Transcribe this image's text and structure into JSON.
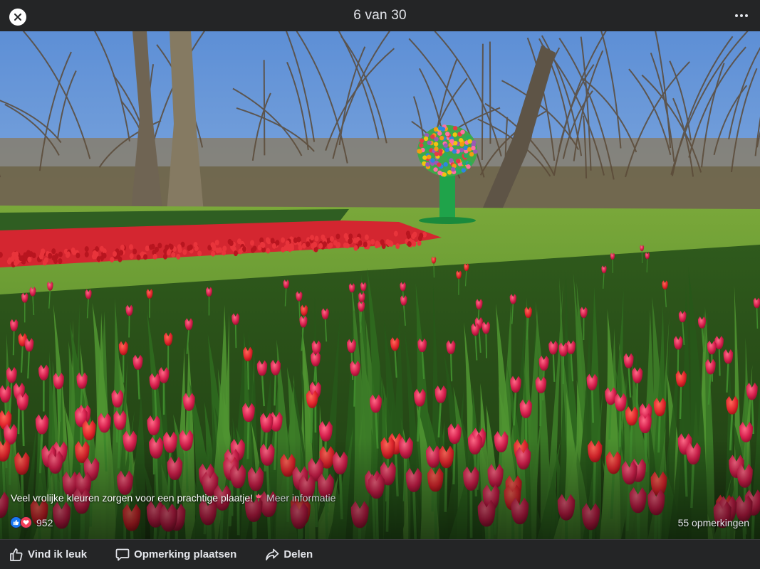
{
  "viewer": {
    "counter": "6 van 30",
    "close_icon": "close-icon",
    "more_icon": "more-horizontal-icon"
  },
  "post": {
    "caption": "Veel vrolijke kleuren zorgen voor een prachtige plaatje!",
    "caption_emoji": "tulip-emoji",
    "more_link": "Meer informatie",
    "reaction_count": "952",
    "comments_count": "55 opmerkingen"
  },
  "actions": {
    "like": "Vind ik leuk",
    "comment": "Opmerking plaatsen",
    "share": "Delen"
  },
  "colors": {
    "bar": "#242526",
    "like": "#1877f2",
    "love": "#f33e58",
    "text": "#e4e6eb"
  }
}
